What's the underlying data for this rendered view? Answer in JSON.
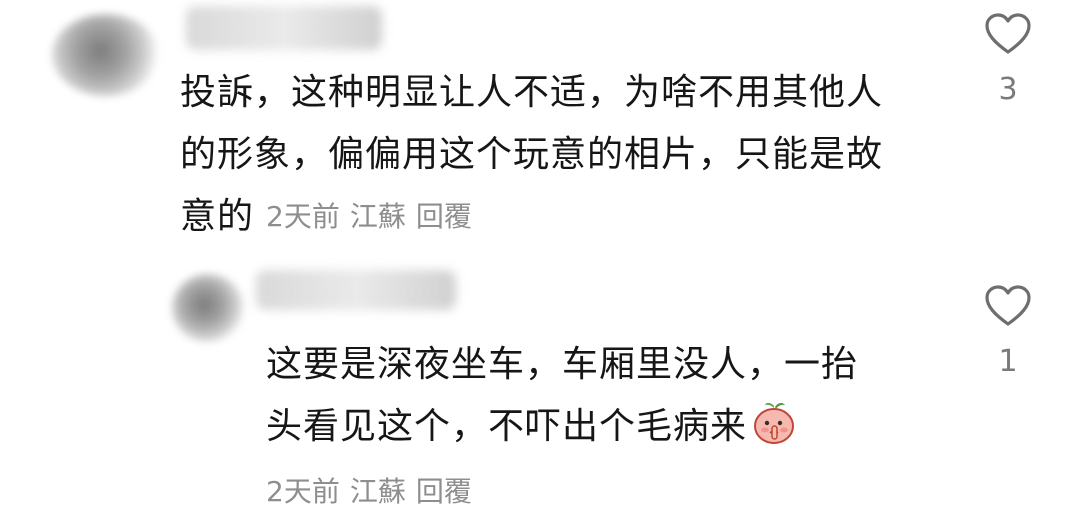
{
  "comments": [
    {
      "text_lines": [
        "投訴，这种明显让人不适，为啥不用其他人",
        "的形象，偏偏用这个玩意的相片，只能是故",
        "意的"
      ],
      "time": "2天前",
      "location": "江蘇",
      "reply_label": "回覆",
      "likes": "3"
    },
    {
      "text_lines": [
        "这要是深夜坐车，车厢里没人，一抬",
        "头看见这个，不吓出个毛病来"
      ],
      "emoji": "shush-peach-emoji",
      "time": "2天前",
      "location": "江蘇",
      "reply_label": "回覆",
      "likes": "1"
    }
  ],
  "icons": {
    "like": "heart-outline-icon"
  },
  "colors": {
    "text": "#161616",
    "meta": "#8e8e8e",
    "icon": "#6e6e6e"
  }
}
